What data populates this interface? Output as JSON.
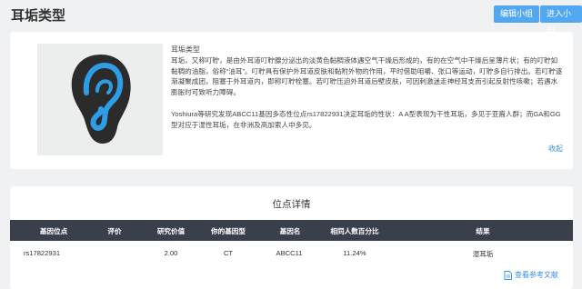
{
  "header": {
    "title": "耳垢类型",
    "edit_group_label": "编辑小组",
    "join_group_label": "进入小组"
  },
  "info": {
    "image_icon": "ear-icon",
    "title": "耳垢类型",
    "paragraph1": "耳垢，又称叮聍，是由外耳道叮聍腺分泌出的淡黄色黏稠液体遇空气干燥后形成的，有的在空气中干燥后呈薄片状；有的叮聍如黏稠的油脂，俗称“油耳”。叮聍具有保护外耳道皮肤和黏附外物的作用，平时借助咀嚼、张口等运动，叮聍多自行排出。若叮聍逐渐凝聚成团，阻塞于外耳道内，即称叮聍栓塞。若叮聍压迫外耳道后壁皮肤，可因刺激迷走神经耳支而引起反射性咳嗽；若遇水膨胀时可致听力障碍。",
    "paragraph2": "Yoshiura等研究发现ABCC11基因多态性位点rs17822931决定耳垢的性状：A A型表现为干性耳垢，多见于亚裔人群；而GA和GG型对应于湿性耳垢，在非洲及高加索人中多见。",
    "collapse_label": "收起"
  },
  "detail": {
    "title": "位点详情",
    "columns": [
      "基因位点",
      "评价",
      "研究价值",
      "你的基因型",
      "基因名",
      "相同人数百分比",
      "结果"
    ],
    "rows": [
      [
        "rs17822931",
        "",
        "2.00",
        "CT",
        "ABCC11",
        "11.24%",
        "湿耳垢"
      ]
    ],
    "reference_label": "查看参考文献",
    "reference_icon": "document-icon"
  },
  "colors": {
    "accent": "#52a8f0",
    "link": "#3a8ee6",
    "table_header": "#3a3f4c",
    "background": "#f0f1f3"
  }
}
